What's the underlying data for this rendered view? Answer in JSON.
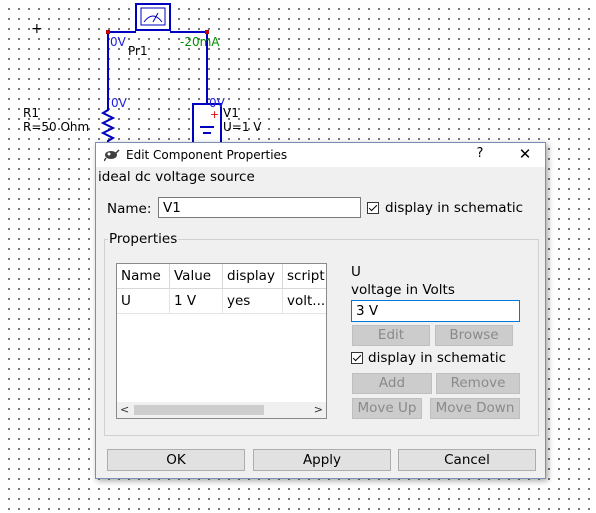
{
  "schematic": {
    "cursor_symbol": "+",
    "probe": {
      "name": "Pr1",
      "left_voltage": "0V",
      "current": "-20mA"
    },
    "resistor": {
      "name": "R1",
      "value": "R=50 Ohm",
      "voltage": "0V"
    },
    "source": {
      "name": "V1",
      "value": "U=1 V",
      "voltage": "0V",
      "plus": "+"
    },
    "colors": {
      "wire": "#0000c0",
      "label_blue": "#2020e0",
      "label_green": "#009000"
    }
  },
  "dialog": {
    "title": "Edit Component Properties",
    "help_label": "?",
    "close_label": "✕",
    "description": "ideal dc voltage source",
    "name_label": "Name:",
    "name_value": "V1",
    "display_checkbox_label": "display in schematic",
    "properties_group_label": "Properties",
    "table": {
      "headers": [
        "Name",
        "Value",
        "display",
        "script"
      ],
      "rows": [
        {
          "name": "U",
          "value": "1 V",
          "display": "yes",
          "description": "volt..."
        }
      ]
    },
    "param_name": "U",
    "param_description": "voltage in Volts",
    "param_value": "3 V",
    "edit_button": "Edit",
    "browse_button": "Browse",
    "param_display_label": "display in schematic",
    "add_button": "Add",
    "remove_button": "Remove",
    "move_up_button": "Move Up",
    "move_down_button": "Move Down",
    "ok_button": "OK",
    "apply_button": "Apply",
    "cancel_button": "Cancel"
  }
}
